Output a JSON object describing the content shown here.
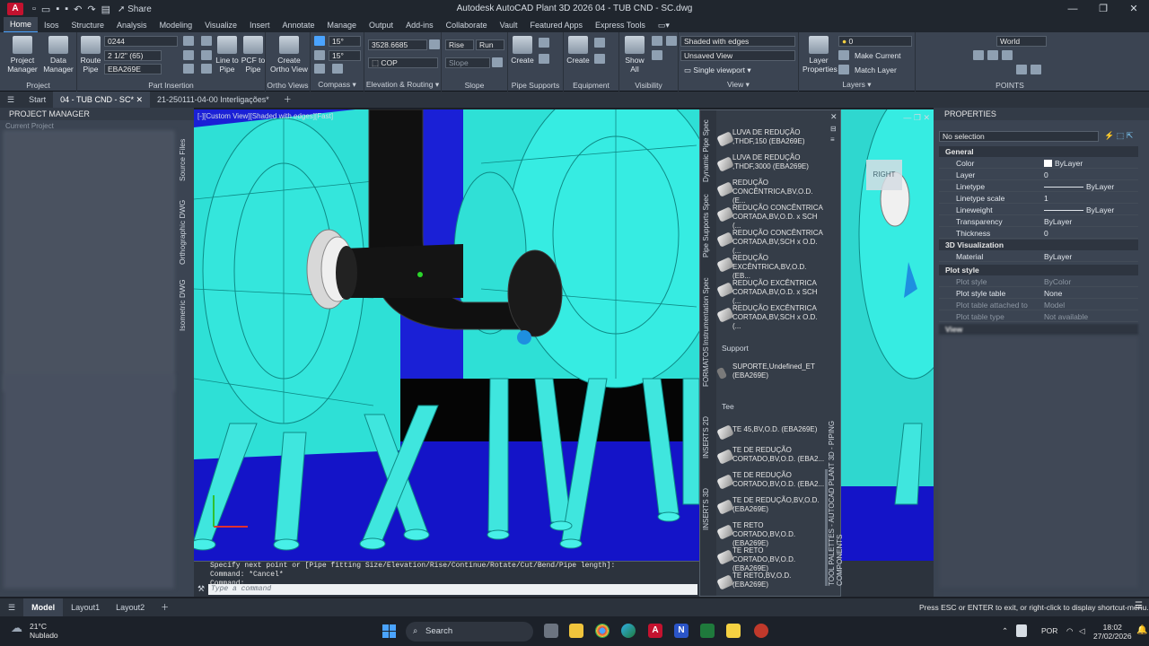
{
  "app": {
    "title": "Autodesk AutoCAD Plant 3D 2026   04 - TUB CND - SC.dwg",
    "logo": "A",
    "share": "Share"
  },
  "ribbon_tabs": [
    "Home",
    "Isos",
    "Structure",
    "Analysis",
    "Modeling",
    "Visualize",
    "Insert",
    "Annotate",
    "Manage",
    "Output",
    "Add-ins",
    "Collaborate",
    "Vault",
    "Featured Apps",
    "Express Tools"
  ],
  "ribbon": {
    "project_manager": "Project\nManager",
    "data_manager": "Data\nManager",
    "project_group": "Project",
    "route_pipe": "Route\nPipe",
    "combo_line": "0244",
    "combo_size": "2 1/2\" (65)",
    "combo_spec": "EBA269E",
    "line_to_pipe": "Line to\nPipe",
    "pcf_to_pipe": "PCF to\nPipe",
    "part_insertion": "Part Insertion",
    "create_ortho": "Create\nOrtho View",
    "ortho_views": "Ortho Views",
    "angle1": "15°",
    "angle2": "15°",
    "compass": "Compass",
    "elevation_value": "3528.6685",
    "cop": "COP",
    "elevation_routing": "Elevation & Routing",
    "rise": "Rise",
    "run": "Run",
    "slope_field": "Slope",
    "slope": "Slope",
    "create_support": "Create",
    "pipe_supports": "Pipe Supports",
    "create_equipment": "Create",
    "equipment": "Equipment",
    "show_all": "Show\nAll",
    "visibility": "Visibility",
    "visual_style": "Shaded with edges",
    "saved_view": "Unsaved View",
    "single_viewport": "Single viewport",
    "view": "View",
    "layer_properties": "Layer\nProperties",
    "layer_combo": "0",
    "make_current": "Make Current",
    "match_layer": "Match Layer",
    "layers": "Layers",
    "ucs": "World",
    "points": "POINTS"
  },
  "file_tabs": [
    "Start",
    "04 - TUB CND - SC*",
    "21-250111-04-00 Interligações*"
  ],
  "project_manager": {
    "title": "PROJECT MANAGER",
    "current_project": "Current Project",
    "side_tabs": [
      "Source Files",
      "Orthographic DWG",
      "Isometric DWG"
    ]
  },
  "viewport": {
    "label": "[-][Custom View][Shaded with edges][Fast]",
    "viewcube_right": "RIGHT"
  },
  "command": {
    "history1": "Specify next point or [Pipe fitting Size/Elevation/Rise/Continue/Rotate/Cut/Bend/Pipe length]:",
    "history2": "Command: *Cancel*",
    "history3": "Command:",
    "placeholder": "Type a command"
  },
  "palette": {
    "title": "TOOL PALETTES - AUTOCAD PLANT 3D - PIPING COMPONENTS",
    "side_tabs": [
      "Dynamic Pipe Spec",
      "Pipe Supports Spec",
      "Instrumentation Spec",
      "FORMATOS",
      "INSERTS 2D",
      "INSERTS 3D"
    ],
    "items": [
      {
        "label": "LUVA DE REDUÇÃO ,THDF,150 (EBA269E)"
      },
      {
        "label": "LUVA DE REDUÇÃO ,THDF,3000 (EBA269E)"
      },
      {
        "label": "REDUÇÃO CONCÊNTRICA,BV,O.D. (E..."
      },
      {
        "label": "REDUÇÃO CONCÊNTRICA CORTADA,BV,O.D. x SCH (..."
      },
      {
        "label": "REDUÇÃO CONCÊNTRICA CORTADA,BV,SCH x O.D. (..."
      },
      {
        "label": "REDUÇÃO EXCÊNTRICA,BV,O.D. (EB..."
      },
      {
        "label": "REDUÇÃO EXCÊNTRICA CORTADA,BV,O.D. x SCH (..."
      },
      {
        "label": "REDUÇÃO EXCÊNTRICA CORTADA,BV,SCH x O.D. (..."
      }
    ],
    "support_section": "Support",
    "support_items": [
      {
        "label": "SUPORTE,Undefined_ET (EBA269E)"
      }
    ],
    "tee_section": "Tee",
    "tee_items": [
      {
        "label": "TE 45,BV,O.D. (EBA269E)"
      },
      {
        "label": "TE DE REDUÇÃO CORTADO,BV,O.D. (EBA2..."
      },
      {
        "label": "TE DE REDUÇÃO CORTADO,BV,O.D. (EBA2..."
      },
      {
        "label": "TE DE REDUÇÃO,BV,O.D. (EBA269E)"
      },
      {
        "label": "TE RETO CORTADO,BV,O.D. (EBA269E)"
      },
      {
        "label": "TE RETO CORTADO,BV,O.D. (EBA269E)"
      },
      {
        "label": "TE RETO,BV,O.D. (EBA269E)"
      }
    ]
  },
  "properties": {
    "title": "PROPERTIES",
    "selection": "No selection",
    "general": "General",
    "rows_general": [
      {
        "k": "Color",
        "v": "ByLayer"
      },
      {
        "k": "Layer",
        "v": "0"
      },
      {
        "k": "Linetype",
        "v": "ByLayer"
      },
      {
        "k": "Linetype scale",
        "v": "1"
      },
      {
        "k": "Lineweight",
        "v": "ByLayer"
      },
      {
        "k": "Transparency",
        "v": "ByLayer"
      },
      {
        "k": "Thickness",
        "v": "0"
      }
    ],
    "viz": "3D Visualization",
    "rows_viz": [
      {
        "k": "Material",
        "v": "ByLayer"
      }
    ],
    "plot": "Plot style",
    "rows_plot": [
      {
        "k": "Plot style",
        "v": "ByColor"
      },
      {
        "k": "Plot style table",
        "v": "None"
      },
      {
        "k": "Plot table attached to",
        "v": "Model"
      },
      {
        "k": "Plot table type",
        "v": "Not available"
      }
    ],
    "view": "View"
  },
  "status": {
    "tabs": [
      "Model",
      "Layout1",
      "Layout2"
    ],
    "message": "Press ESC or ENTER to exit, or right-click to display shortcut-menu."
  },
  "taskbar": {
    "temp": "21°C",
    "weather": "Nublado",
    "search": "Search",
    "lang": "POR",
    "time": "18:02",
    "date": "27/02/2026"
  },
  "colors": {
    "accent": "#4aa3ff",
    "model_cyan": "#2fd7cf",
    "floor_blue": "#1a1adf",
    "brand_red": "#c4122f"
  }
}
